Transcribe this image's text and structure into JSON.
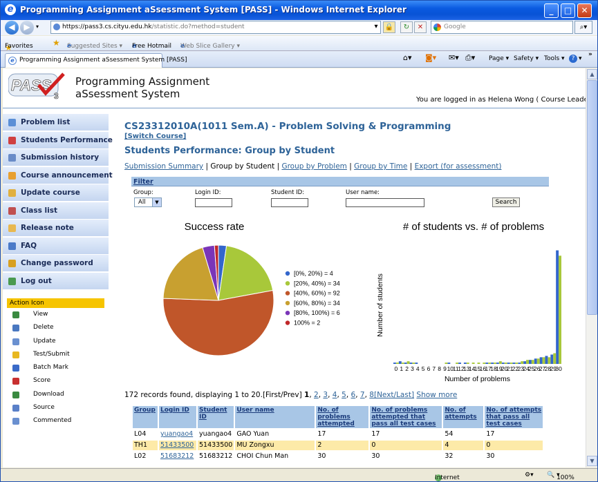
{
  "browser": {
    "title": "Programming Assignment aSsessment System [PASS] - Windows Internet Explorer",
    "url_host": "https://pass3.cs.",
    "url_domain": "cityu.edu.hk",
    "url_path": "/statistic.do?method=student",
    "search_placeholder": "Google",
    "favorites": "Favorites",
    "suggested_sites": "Suggested Sites ▾",
    "free_hotmail": "Free Hotmail",
    "web_slice": "Web Slice Gallery ▾",
    "tab_title": "Programming Assignment aSsessment System [PASS]",
    "cmd_page": "Page ▾",
    "cmd_safety": "Safety ▾",
    "cmd_tools": "Tools ▾",
    "cmd_help": "? ▾",
    "status_zone": "Internet",
    "status_zoom": "100%"
  },
  "header": {
    "logo_text": "PASS",
    "logo_sub": "3",
    "app_line1": "Programming Assignment",
    "app_line2": "aSsessment System",
    "logged_in": "You are logged in as Helena Wong ( Course Leader )."
  },
  "sidebar": {
    "items": [
      {
        "label": "Problem list",
        "color": "#5b8fd6"
      },
      {
        "label": "Students Performance",
        "color": "#d04040"
      },
      {
        "label": "Submission history",
        "color": "#6a8cc8"
      },
      {
        "label": "Course announcement",
        "color": "#e8a030"
      },
      {
        "label": "Update course",
        "color": "#e0b040"
      },
      {
        "label": "Class list",
        "color": "#c05050"
      },
      {
        "label": "Release note",
        "color": "#e8b850"
      },
      {
        "label": "FAQ",
        "color": "#4a7ac8"
      },
      {
        "label": "Change password",
        "color": "#d8a020"
      },
      {
        "label": "Log out",
        "color": "#4a9a50"
      }
    ],
    "action_title": "Action Icon",
    "actions": [
      {
        "label": "View",
        "color": "#3a8a40"
      },
      {
        "label": "Delete",
        "color": "#4a78c0"
      },
      {
        "label": "Update",
        "color": "#6a90d0"
      },
      {
        "label": "Test/Submit",
        "color": "#e8b820"
      },
      {
        "label": "Batch Mark",
        "color": "#3a6ac8"
      },
      {
        "label": "Score",
        "color": "#c83030"
      },
      {
        "label": "Download",
        "color": "#3a8a40"
      },
      {
        "label": "Source",
        "color": "#5a80c8"
      },
      {
        "label": "Commented",
        "color": "#6a90d0"
      }
    ]
  },
  "content": {
    "course_title": "CS23312010A(1011 Sem.A) - Problem Solving & Programming",
    "switch_course": "[Switch Course]",
    "page_title": "Students Performance: Group by Student",
    "links": {
      "summary": "Submission Summary",
      "sep": " | ",
      "current": "Group by Student",
      "by_problem": "Group by Problem",
      "by_time": "Group by Time",
      "export": "Export (for assessment)"
    },
    "filter": {
      "title": "Filter",
      "group_label": "Group:",
      "group_value": "All",
      "login_label": "Login ID:",
      "student_label": "Student ID:",
      "user_label": "User name:",
      "search_button": "Search"
    }
  },
  "chart_data": [
    {
      "type": "pie",
      "title": "Success rate",
      "categories": [
        "[0%, 20%) = 4",
        "[20%, 40%) = 34",
        "[40%, 60%) = 92",
        "[60%, 80%) = 34",
        "[80%, 100%) = 6",
        "100% = 2"
      ],
      "values": [
        4,
        34,
        92,
        34,
        6,
        2
      ],
      "colors": [
        "#3366cc",
        "#a8c83a",
        "#c0562a",
        "#c8a030",
        "#7a35b8",
        "#c0282a"
      ],
      "legend": "right"
    },
    {
      "type": "bar",
      "title": "# of students vs. # of problems",
      "xlabel": "Number of problems",
      "ylabel": "Number of students",
      "categories": [
        "0",
        "1",
        "2",
        "3",
        "4",
        "5",
        "6",
        "7",
        "8",
        "9",
        "10",
        "11",
        "12",
        "13",
        "14",
        "15",
        "16",
        "17",
        "18",
        "19",
        "20",
        "21",
        "22",
        "23",
        "24",
        "25",
        "26",
        "27",
        "28",
        "29",
        "30"
      ],
      "series": [
        {
          "values": [
            1,
            2,
            1,
            1,
            1,
            0,
            0,
            0,
            0,
            0,
            1,
            0,
            1,
            1,
            0,
            0,
            0,
            1,
            1,
            1,
            1,
            1,
            1,
            1,
            2,
            3,
            4,
            5,
            6,
            7,
            85
          ],
          "color": "#3366cc"
        },
        {
          "values": [
            1,
            1,
            2,
            1,
            0,
            0,
            0,
            0,
            0,
            1,
            0,
            1,
            0,
            1,
            1,
            1,
            1,
            1,
            1,
            2,
            1,
            1,
            1,
            2,
            3,
            3,
            4,
            5,
            5,
            8,
            81
          ],
          "color": "#a8c83a"
        }
      ],
      "ylim": [
        0,
        92
      ],
      "grid": false,
      "legend": "none"
    }
  ],
  "records": {
    "summary": "172 records found, displaying 1 to 20.",
    "first_prev": "[First/Prev]",
    "current_page": "1",
    "pages": [
      "2",
      "3",
      "4",
      "5",
      "6",
      "7",
      "8"
    ],
    "next_last": "[Next/Last]",
    "show_more": "Show more"
  },
  "table": {
    "headers": [
      "Group",
      "Login ID",
      "Student ID",
      "User name",
      "No. of problems attempted",
      "No. of problems attempted that pass all test cases",
      "No. of attempts",
      "No. of attempts that pass all test cases"
    ],
    "rows": [
      [
        "L04",
        "yuangao4",
        "yuangao4",
        "GAO Yuan",
        "17",
        "17",
        "54",
        "17"
      ],
      [
        "TH1",
        "51433500",
        "51433500",
        "MU Zongxu",
        "2",
        "0",
        "4",
        "0"
      ],
      [
        "L02",
        "51683212",
        "51683212",
        "CHOI Chun Man",
        "30",
        "30",
        "32",
        "30"
      ]
    ]
  }
}
